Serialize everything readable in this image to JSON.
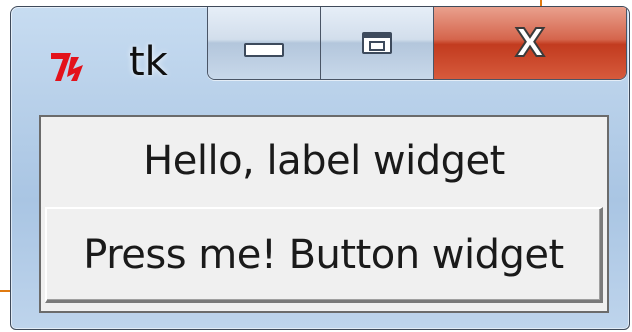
{
  "window": {
    "title": "tk",
    "app_icon": "tk-feather-icon",
    "caption_buttons": {
      "minimize_icon": "minimize-icon",
      "maximize_icon": "maximize-icon",
      "close_icon": "close-icon",
      "close_glyph": "X"
    },
    "colors": {
      "close": "#c9432a",
      "frame": "#b9d1ea",
      "client": "#f0f0f0"
    }
  },
  "content": {
    "label_text": "Hello, label widget",
    "button_text": "Press me! Button widget"
  }
}
